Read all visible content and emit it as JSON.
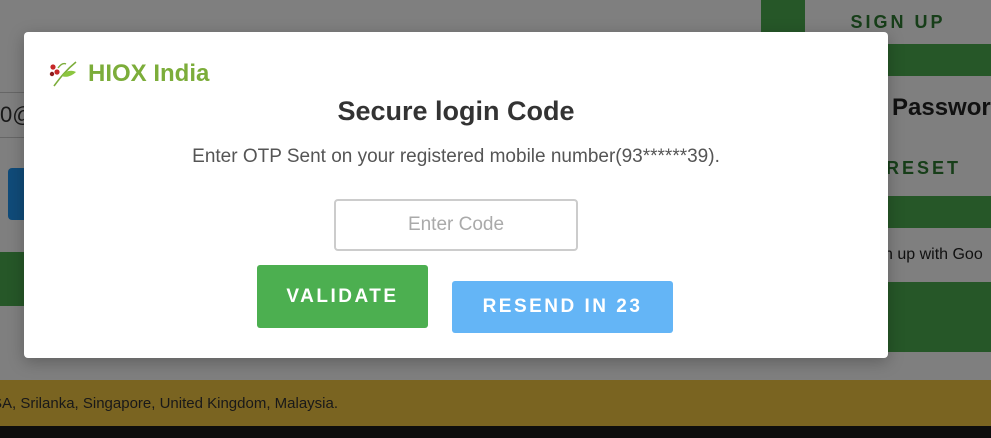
{
  "background": {
    "signup_label": "SIGN UP",
    "password_label": "Passwor",
    "reset_label": "RESET",
    "google_label": "n up with Goo",
    "input_fragment": "0@",
    "footer_text": "SA, Srilanka, Singapore, United Kingdom, Malaysia."
  },
  "modal": {
    "brand_name": "HIOX India",
    "brand_logo_icon": "leaf-berry-logo-icon",
    "title": "Secure login Code",
    "description": "Enter OTP Sent on your registered mobile number(93******39).",
    "code_input": {
      "placeholder": "Enter Code",
      "value": ""
    },
    "validate_label": "VALIDATE",
    "resend_label": "RESEND IN 23"
  },
  "colors": {
    "brand_green": "#7cad3a",
    "validate_green": "#4caf50",
    "resend_blue": "#64b5f6",
    "footer_yellow": "#f5c842"
  }
}
